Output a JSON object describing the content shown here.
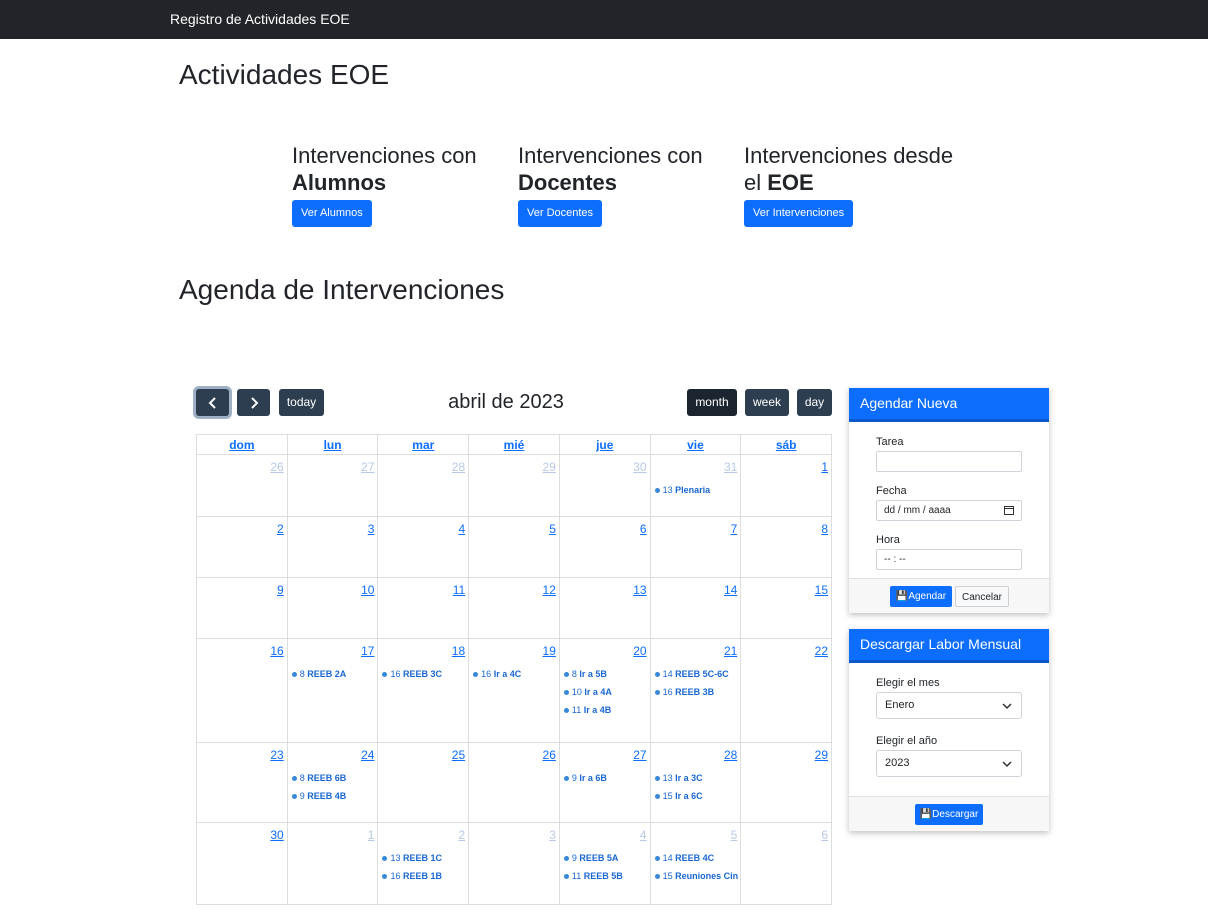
{
  "navbar": {
    "brand": "Registro de Actividades EOE"
  },
  "page_title": "Actividades EOE",
  "cards": [
    {
      "line1": "Intervenciones con",
      "line2_prefix": "",
      "line2_bold": "Alumnos",
      "button": "Ver Alumnos"
    },
    {
      "line1": "Intervenciones con",
      "line2_prefix": "",
      "line2_bold": "Docentes",
      "button": "Ver Docentes"
    },
    {
      "line1": "Intervenciones desde",
      "line2_prefix": "el ",
      "line2_bold": "EOE",
      "button": "Ver Intervenciones"
    }
  ],
  "agenda_title": "Agenda de Intervenciones",
  "calendar": {
    "title": "abril de 2023",
    "prev_icon": "chevron-left-icon",
    "next_icon": "chevron-right-icon",
    "today_label": "today",
    "views": [
      "month",
      "week",
      "day"
    ],
    "active_view": "month",
    "weekdays": [
      "dom",
      "lun",
      "mar",
      "mié",
      "jue",
      "vie",
      "sáb"
    ],
    "weeks": [
      [
        {
          "d": "26",
          "other": true
        },
        {
          "d": "27",
          "other": true
        },
        {
          "d": "28",
          "other": true
        },
        {
          "d": "29",
          "other": true
        },
        {
          "d": "30",
          "other": true
        },
        {
          "d": "31",
          "other": true,
          "events": [
            [
              "13",
              "Plenaria"
            ]
          ]
        },
        {
          "d": "1"
        }
      ],
      [
        {
          "d": "2"
        },
        {
          "d": "3"
        },
        {
          "d": "4"
        },
        {
          "d": "5"
        },
        {
          "d": "6"
        },
        {
          "d": "7"
        },
        {
          "d": "8"
        }
      ],
      [
        {
          "d": "9"
        },
        {
          "d": "10"
        },
        {
          "d": "11"
        },
        {
          "d": "12"
        },
        {
          "d": "13"
        },
        {
          "d": "14"
        },
        {
          "d": "15"
        }
      ],
      [
        {
          "d": "16"
        },
        {
          "d": "17",
          "events": [
            [
              "8",
              "REEB 2A"
            ]
          ]
        },
        {
          "d": "18",
          "events": [
            [
              "16",
              "REEB 3C"
            ]
          ]
        },
        {
          "d": "19",
          "events": [
            [
              "16",
              "Ir a 4C"
            ]
          ]
        },
        {
          "d": "20",
          "events": [
            [
              "8",
              "Ir a 5B"
            ],
            [
              "10",
              "Ir a 4A"
            ],
            [
              "11",
              "Ir a 4B"
            ]
          ]
        },
        {
          "d": "21",
          "events": [
            [
              "14",
              "REEB 5C-6C"
            ],
            [
              "16",
              "REEB 3B"
            ]
          ]
        },
        {
          "d": "22"
        }
      ],
      [
        {
          "d": "23"
        },
        {
          "d": "24",
          "events": [
            [
              "8",
              "REEB 6B"
            ],
            [
              "9",
              "REEB 4B"
            ]
          ]
        },
        {
          "d": "25"
        },
        {
          "d": "26"
        },
        {
          "d": "27",
          "events": [
            [
              "9",
              "Ir a 6B"
            ]
          ]
        },
        {
          "d": "28",
          "events": [
            [
              "13",
              "Ir a 3C"
            ],
            [
              "15",
              "Ir a 6C"
            ]
          ]
        },
        {
          "d": "29"
        }
      ],
      [
        {
          "d": "30"
        },
        {
          "d": "1",
          "other": true
        },
        {
          "d": "2",
          "other": true,
          "events": [
            [
              "13",
              "REEB 1C"
            ],
            [
              "16",
              "REEB 1B"
            ]
          ]
        },
        {
          "d": "3",
          "other": true
        },
        {
          "d": "4",
          "other": true,
          "events": [
            [
              "9",
              "REEB 5A"
            ],
            [
              "11",
              "REEB 5B"
            ]
          ]
        },
        {
          "d": "5",
          "other": true,
          "events": [
            [
              "14",
              "REEB 4C"
            ],
            [
              "15",
              "Reuniones Cint"
            ]
          ]
        },
        {
          "d": "6",
          "other": true
        }
      ]
    ]
  },
  "agendar": {
    "header": "Agendar Nueva",
    "tarea_label": "Tarea",
    "tarea_value": "",
    "fecha_label": "Fecha",
    "fecha_placeholder": "dd / mm / aaaa",
    "hora_label": "Hora",
    "hora_placeholder": "-- : --",
    "submit": "Agendar",
    "cancel": "Cancelar"
  },
  "descargar": {
    "header": "Descargar Labor Mensual",
    "mes_label": "Elegir el mes",
    "mes_value": "Enero",
    "anio_label": "Elegir el año",
    "anio_value": "2023",
    "submit": "Descargar"
  }
}
